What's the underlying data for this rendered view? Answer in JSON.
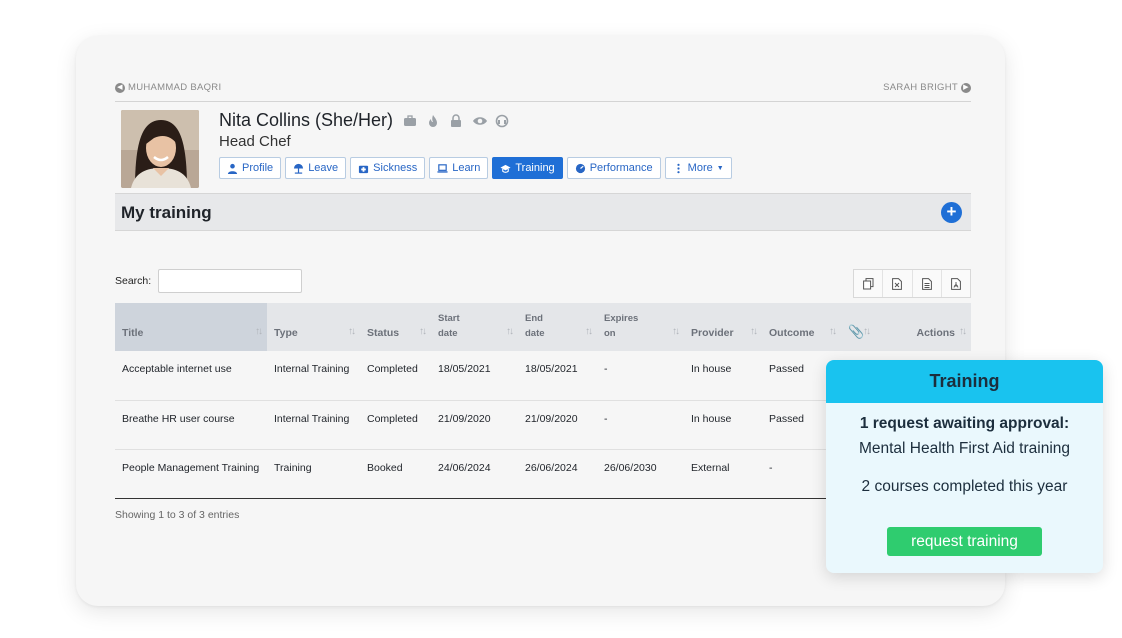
{
  "nav": {
    "prev_employee": "MUHAMMAD BAQRI",
    "next_employee": "SARAH BRIGHT"
  },
  "employee": {
    "name": "Nita Collins (She/Her)",
    "job_title": "Head Chef"
  },
  "tabs": [
    {
      "label": "Profile",
      "icon": "user-icon",
      "active": false
    },
    {
      "label": "Leave",
      "icon": "beach-umbrella-icon",
      "active": false
    },
    {
      "label": "Sickness",
      "icon": "medical-kit-icon",
      "active": false
    },
    {
      "label": "Learn",
      "icon": "laptop-icon",
      "active": false
    },
    {
      "label": "Training",
      "icon": "graduation-cap-icon",
      "active": true
    },
    {
      "label": "Performance",
      "icon": "gauge-icon",
      "active": false
    },
    {
      "label": "More",
      "icon": "vertical-dots-icon",
      "active": false
    }
  ],
  "section": {
    "title": "My training",
    "add_label": "+"
  },
  "search": {
    "label": "Search:",
    "value": ""
  },
  "table": {
    "headers": [
      "Title",
      "Type",
      "Status",
      "Start date",
      "End date",
      "Expires on",
      "Provider",
      "Outcome",
      "",
      "Actions"
    ],
    "rows": [
      [
        "Acceptable internet use",
        "Internal Training",
        "Completed",
        "18/05/2021",
        "18/05/2021",
        "-",
        "In house",
        "Passed"
      ],
      [
        "Breathe HR user course",
        "Internal Training",
        "Completed",
        "21/09/2020",
        "21/09/2020",
        "-",
        "In house",
        "Passed"
      ],
      [
        "People Management Training",
        "Training",
        "Booked",
        "24/06/2024",
        "26/06/2024",
        "26/06/2030",
        "External",
        "-"
      ]
    ],
    "footer": "Showing 1 to 3 of 3 entries"
  },
  "popup": {
    "title": "Training",
    "line1": "1 request awaiting approval:",
    "line2": "Mental Health First Aid training",
    "line3": "2 courses completed this year",
    "button": "request training"
  },
  "colors": {
    "primary": "#1f6fd6",
    "popup_header": "#19c3ef",
    "popup_bg": "#eaf8fd",
    "cta": "#2fcc6f"
  }
}
